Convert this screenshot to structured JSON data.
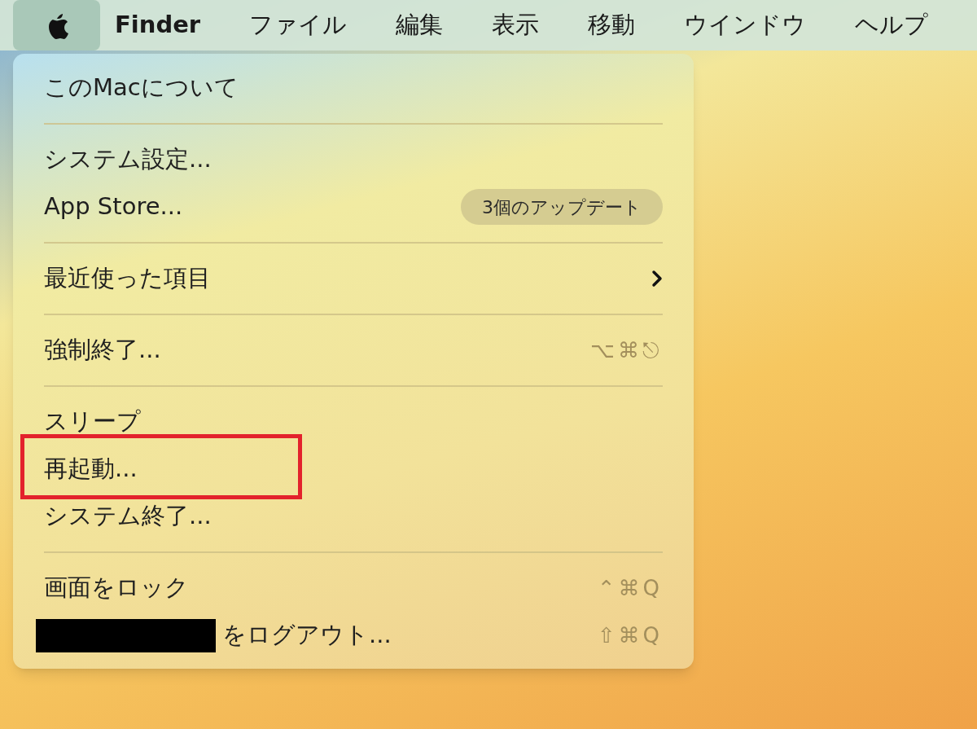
{
  "menu_bar": {
    "apple_menu": {
      "selected": true
    },
    "items": [
      {
        "label": "Finder",
        "kind": "app"
      },
      {
        "label": "ファイル",
        "kind": "menu"
      },
      {
        "label": "編集",
        "kind": "menu"
      },
      {
        "label": "表示",
        "kind": "menu"
      },
      {
        "label": "移動",
        "kind": "menu"
      },
      {
        "label": "ウインドウ",
        "kind": "menu"
      },
      {
        "label": "ヘルプ",
        "kind": "menu"
      }
    ]
  },
  "apple_menu": {
    "items": [
      {
        "kind": "item",
        "label": "このMacについて"
      },
      {
        "kind": "separator"
      },
      {
        "kind": "item",
        "label": "システム設定..."
      },
      {
        "kind": "item",
        "label": "App Store...",
        "badge": "3個のアップデート"
      },
      {
        "kind": "separator"
      },
      {
        "kind": "item",
        "label": "最近使った項目",
        "submenu": true
      },
      {
        "kind": "separator"
      },
      {
        "kind": "item",
        "label": "強制終了...",
        "shortcut": "⌥⌘⎋"
      },
      {
        "kind": "separator"
      },
      {
        "kind": "item",
        "label": "スリープ"
      },
      {
        "kind": "item",
        "label": "再起動...",
        "highlighted": true
      },
      {
        "kind": "item",
        "label": "システム終了..."
      },
      {
        "kind": "separator"
      },
      {
        "kind": "item",
        "label": "画面をロック",
        "shortcut": "⌃⌘Q"
      },
      {
        "kind": "item",
        "label": "をログアウト...",
        "redacted": true,
        "shortcut": "⇧⌘Q"
      }
    ]
  }
}
